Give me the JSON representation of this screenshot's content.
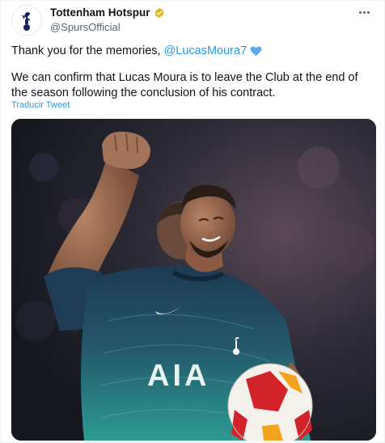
{
  "tweet": {
    "display_name": "Tottenham Hotspur",
    "handle": "@SpursOfficial",
    "line1_text": "Thank you for the memories, ",
    "mention": "@LucasMoura7",
    "body": "We can confirm that Lucas Moura is to leave the Club at the end of the season following the conclusion of his contract.",
    "translate_label": "Traducir Tweet"
  },
  "photo": {
    "shirt_sponsor": "AIA"
  },
  "colors": {
    "accent": "#1d9bf0",
    "verified_gold": "#e2b719",
    "heart": "#5ea9ee",
    "shirt_teal": "#2c9b91",
    "shirt_navy": "#1d3a52"
  },
  "icons": [
    "club-crest-icon",
    "verified-badge-icon",
    "more-icon",
    "blue-heart-icon"
  ]
}
